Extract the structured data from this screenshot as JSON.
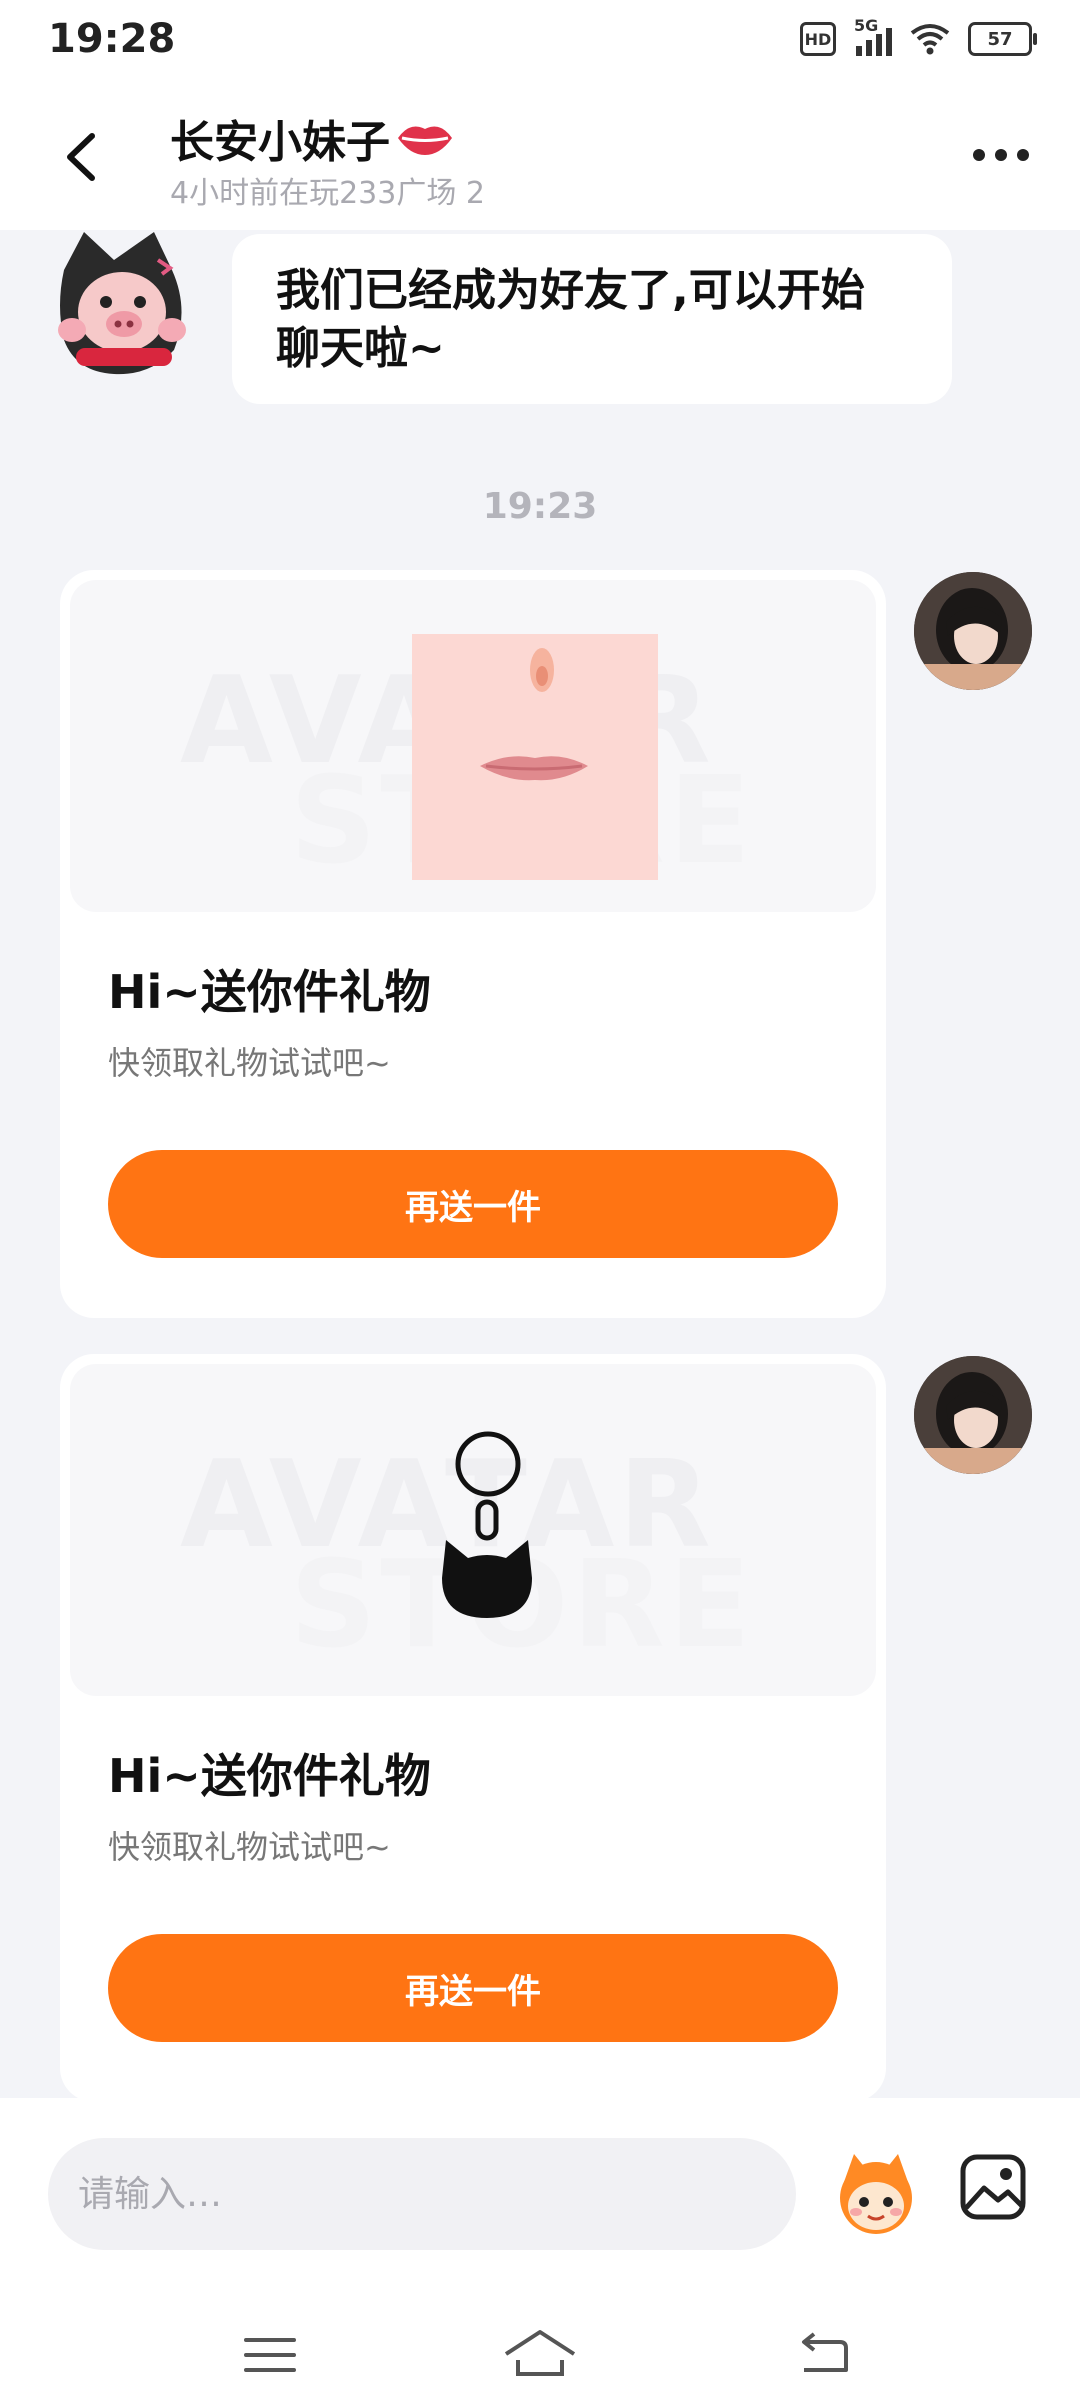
{
  "status_bar": {
    "time": "19:28",
    "hd": "HD",
    "network": "5G",
    "battery": "57"
  },
  "header": {
    "contact_name": "长安小妹子",
    "status": "4小时前在玩233广场  2"
  },
  "messages": {
    "friend_bubble": "我们已经成为好友了,可以开始聊天啦~",
    "time_separator": "19:23",
    "gifts": [
      {
        "title": "Hi~送你件礼物",
        "subtitle": "快领取礼物试试吧~",
        "button": "再送一件",
        "item_icon": "lips-icon"
      },
      {
        "title": "Hi~送你件礼物",
        "subtitle": "快领取礼物试试吧~",
        "button": "再送一件",
        "item_icon": "cat-keychain-icon"
      }
    ],
    "watermark": [
      "AVATAR",
      "STORE"
    ]
  },
  "input": {
    "placeholder": "请输入…"
  },
  "colors": {
    "accent": "#ff7413",
    "background": "#f3f4f8"
  },
  "icons": [
    "back-arrow-icon",
    "more-icon",
    "mascot-icon",
    "image-icon",
    "menu-icon",
    "home-icon",
    "back-icon"
  ]
}
